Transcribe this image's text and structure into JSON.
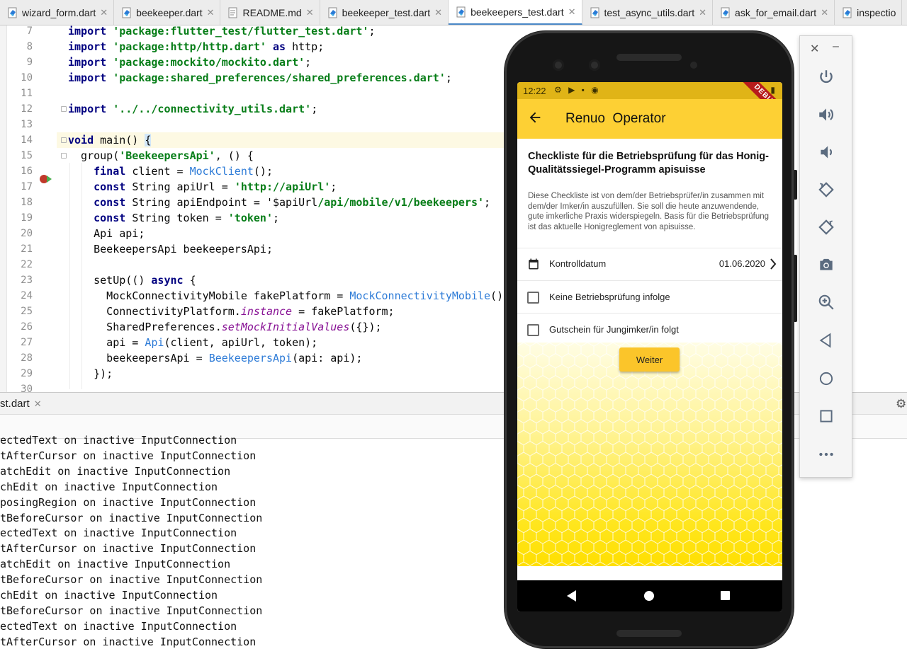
{
  "tabs": [
    {
      "label": "wizard_form.dart",
      "active": false
    },
    {
      "label": "beekeeper.dart",
      "active": false
    },
    {
      "label": "README.md",
      "active": false
    },
    {
      "label": "beekeeper_test.dart",
      "active": false
    },
    {
      "label": "beekeepers_test.dart",
      "active": true
    },
    {
      "label": "test_async_utils.dart",
      "active": false
    },
    {
      "label": "ask_for_email.dart",
      "active": false
    },
    {
      "label": "inspectio",
      "active": false
    }
  ],
  "editor": {
    "line_numbers": [
      "7",
      "8",
      "9",
      "10",
      "11",
      "12",
      "13",
      "14",
      "15",
      "16",
      "17",
      "18",
      "19",
      "20",
      "21",
      "22",
      "23",
      "24",
      "25",
      "26",
      "27",
      "28",
      "29",
      "30"
    ],
    "lines": {
      "l7": {
        "kw": "import",
        "str": "'package:flutter_test/flutter_test.dart'",
        "rest": ";"
      },
      "l8": {
        "kw": "import",
        "str": "'package:http/http.dart'",
        "kw2": "as",
        "rest": "http;"
      },
      "l9": {
        "kw": "import",
        "str": "'package:mockito/mockito.dart'",
        "rest": ";"
      },
      "l10": {
        "kw": "import",
        "str": "'package:shared_preferences/shared_preferences.dart'",
        "rest": ";"
      },
      "l12": {
        "kw": "import",
        "str": "'../../connectivity_utils.dart'",
        "rest": ";"
      },
      "l14": {
        "kw": "void",
        "rest": "main() ",
        "brace": "{"
      },
      "l15": {
        "pre": "  group(",
        "str": "'BeekeepersApi'",
        "rest": ", () {"
      },
      "l16": {
        "kw": "final",
        "mid": "client = ",
        "cls": "MockClient",
        "rest": "();"
      },
      "l17": {
        "kw": "const",
        "mid": "String apiUrl = ",
        "str": "'http://apiUrl'",
        "rest": ";"
      },
      "l18": {
        "kw": "const",
        "mid": "String apiEndpoint = ",
        "plain": "'$apiUrl",
        "str": "/api/mobile/v1/beekeepers'",
        "rest": ";"
      },
      "l19": {
        "kw": "const",
        "mid": "String token = ",
        "str": "'token'",
        "rest": ";"
      },
      "l20": {
        "text": "    Api api;"
      },
      "l21": {
        "text": "    BeekeepersApi beekeepersApi;"
      },
      "l23": {
        "pre": "    setUp(() ",
        "kw": "async",
        "rest": " {"
      },
      "l24": {
        "pre": "      MockConnectivityMobile fakePlatform = ",
        "cls": "MockConnectivityMobile",
        "rest": "();"
      },
      "l25": {
        "pre": "      ConnectivityPlatform.",
        "it": "instance",
        "rest": " = fakePlatform;"
      },
      "l26": {
        "pre": "      SharedPreferences.",
        "it": "setMockInitialValues",
        "rest": "({});"
      },
      "l27": {
        "pre": "      api = ",
        "cls": "Api",
        "rest": "(client, apiUrl, token);"
      },
      "l28": {
        "pre": "      beekeepersApi = ",
        "cls": "BeekeepersApi",
        "rest": "(api: api);"
      },
      "l29": {
        "text": "    });"
      }
    }
  },
  "run_panel": {
    "tab_label": "st.dart",
    "console_lines": [
      "ectedText on inactive InputConnection",
      "tAfterCursor on inactive InputConnection",
      "atchEdit on inactive InputConnection",
      "chEdit on inactive InputConnection",
      "posingRegion on inactive InputConnection",
      "tBeforeCursor on inactive InputConnection",
      "ectedText on inactive InputConnection",
      "tAfterCursor on inactive InputConnection",
      "atchEdit on inactive InputConnection",
      "tBeforeCursor on inactive InputConnection",
      "chEdit on inactive InputConnection",
      "tBeforeCursor on inactive InputConnection",
      "ectedText on inactive InputConnection",
      "tAfterCursor on inactive InputConnection"
    ]
  },
  "emulator_toolbar": {
    "buttons": [
      "power-icon",
      "volume-up-icon",
      "volume-down-icon",
      "rotate-left-icon",
      "rotate-right-icon",
      "camera-icon",
      "zoom-in-icon",
      "back-triangle-icon",
      "home-circle-icon",
      "overview-square-icon",
      "more-icon"
    ]
  },
  "phone": {
    "status_time": "12:22",
    "debug_label": "DEBUG",
    "appbar_title": "Renuo  Operator",
    "checklist_title": "Checkliste für die Betriebsprüfung für das Honig-Qualitätssiegel-Programm apisuisse",
    "checklist_description": "Diese Checkliste ist von dem/der Betriebsprüfer/in zusammen mit dem/der Imker/in auszufüllen. Sie soll die heute anzuwendende, gute imkerliche Praxis widerspiegeln. Basis für die Betriebsprüfung ist das aktuelle Honigreglement von apisuisse.",
    "date_label": "Kontrolldatum",
    "date_value": "01.06.2020",
    "checkbox1_label": "Keine Betriebsprüfung infolge",
    "checkbox1_checked": false,
    "checkbox2_label": "Gutschein für Jungimker/in folgt",
    "checkbox2_checked": false,
    "continue_button": "Weiter"
  },
  "colors": {
    "appbar": "#fdd034",
    "statusbar": "#e0b417",
    "button": "#fbc52a",
    "active_tab_underline": "#4a88c7"
  }
}
